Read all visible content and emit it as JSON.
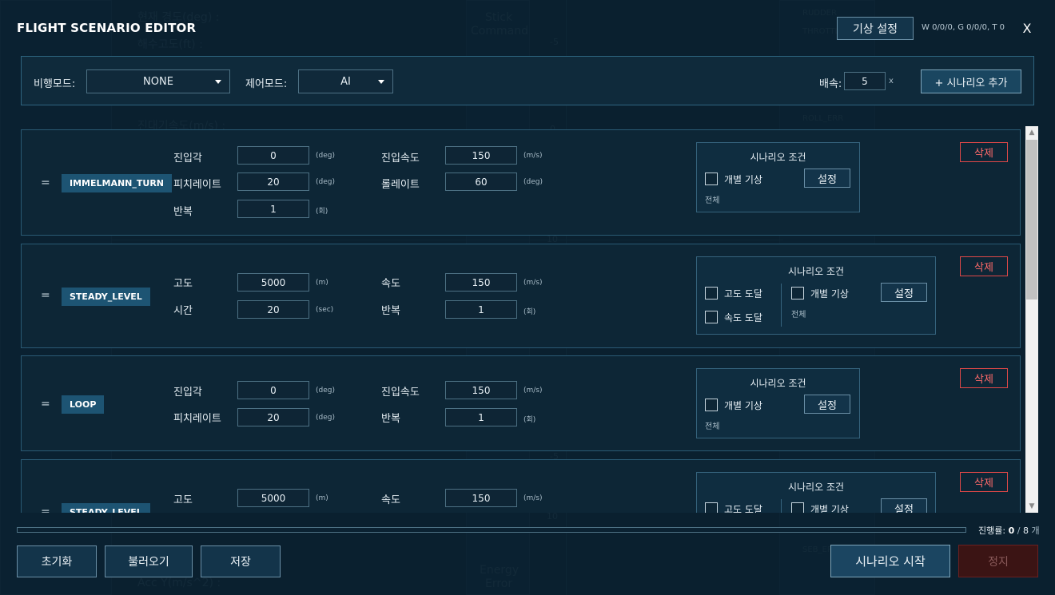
{
  "window": {
    "title": "FLIGHT SCENARIO EDITOR",
    "weather_button": "기상 설정",
    "weather_status": "W 0/0/0, G 0/0/0, T 0",
    "close_label": "X"
  },
  "background": {
    "texts": [
      "현재 경도(deg) :",
      "해수고도(ft) :",
      "진대기속도(m/s) :",
      "Stick",
      "Command",
      "RUDDER",
      "THROTTLE",
      "ROLL_ERR",
      "Energy",
      "Error",
      "Acc Y(m/s^2) :",
      "SEB_ERR",
      "-5",
      "0",
      "10",
      "-5",
      "10"
    ]
  },
  "toolbar": {
    "flight_mode_label": "비행모드:",
    "flight_mode_value": "NONE",
    "control_mode_label": "제어모드:",
    "control_mode_value": "AI",
    "speed_label": "배속:",
    "speed_value": "5",
    "speed_unit": "x",
    "add_button": "+ 시나리오 추가"
  },
  "scenarios": [
    {
      "drag": "=",
      "name": "IMMELMANN_TURN",
      "fields": [
        {
          "label": "진입각",
          "value": "0",
          "unit": "(deg)"
        },
        {
          "label": "진입속도",
          "value": "150",
          "unit": "(m/s)"
        },
        {
          "label": "피치레이트",
          "value": "20",
          "unit": "(deg)"
        },
        {
          "label": "롤레이트",
          "value": "60",
          "unit": "(deg)"
        },
        {
          "label": "반복",
          "value": "1",
          "unit": "(회)"
        }
      ],
      "condition": {
        "title": "시나리오 조건",
        "weather": "개별 기상",
        "set_button": "설정",
        "all": "전체"
      },
      "delete": "삭제"
    },
    {
      "drag": "=",
      "name": "STEADY_LEVEL",
      "fields": [
        {
          "label": "고도",
          "value": "5000",
          "unit": "(m)"
        },
        {
          "label": "속도",
          "value": "150",
          "unit": "(m/s)"
        },
        {
          "label": "시간",
          "value": "20",
          "unit": "(sec)"
        },
        {
          "label": "반복",
          "value": "1",
          "unit": "(회)"
        }
      ],
      "condition": {
        "title": "시나리오 조건",
        "alt_reach": "고도 도달",
        "spd_reach": "속도 도달",
        "weather": "개별 기상",
        "set_button": "설정",
        "all": "전체"
      },
      "delete": "삭제"
    },
    {
      "drag": "=",
      "name": "LOOP",
      "fields": [
        {
          "label": "진입각",
          "value": "0",
          "unit": "(deg)"
        },
        {
          "label": "진입속도",
          "value": "150",
          "unit": "(m/s)"
        },
        {
          "label": "피치레이트",
          "value": "20",
          "unit": "(deg)"
        },
        {
          "label": "반복",
          "value": "1",
          "unit": "(회)"
        }
      ],
      "condition": {
        "title": "시나리오 조건",
        "weather": "개별 기상",
        "set_button": "설정",
        "all": "전체"
      },
      "delete": "삭제"
    },
    {
      "drag": "=",
      "name": "STEADY_LEVEL",
      "fields": [
        {
          "label": "고도",
          "value": "5000",
          "unit": "(m)"
        },
        {
          "label": "속도",
          "value": "150",
          "unit": "(m/s)"
        }
      ],
      "condition": {
        "title": "시나리오 조건",
        "alt_reach": "고도 도달",
        "weather": "개별 기상",
        "set_button": "설정"
      },
      "delete": "삭제"
    }
  ],
  "progress": {
    "label": "진행률:",
    "done": "0",
    "sep": "/",
    "total": "8",
    "unit": "개",
    "fraction": 0
  },
  "footer": {
    "reset": "초기화",
    "load": "불러오기",
    "save": "저장",
    "start": "시나리오 시작",
    "stop": "정지"
  }
}
